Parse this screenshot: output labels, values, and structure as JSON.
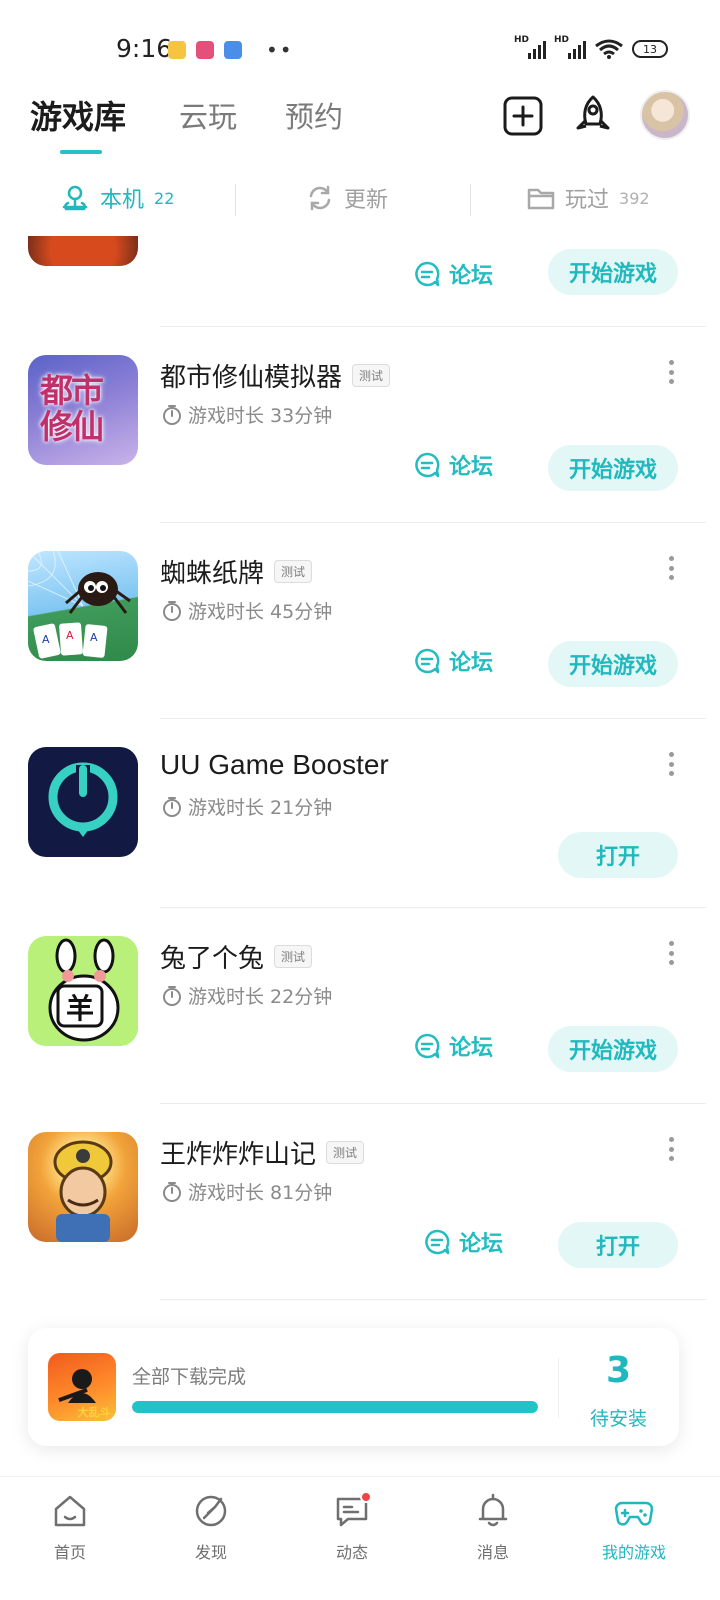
{
  "status_bar": {
    "time": "9:16",
    "signal_1": "HD",
    "signal_2": "HD",
    "battery": "13"
  },
  "header": {
    "tabs": [
      {
        "label": "游戏库",
        "active": true
      },
      {
        "label": "云玩",
        "active": false
      },
      {
        "label": "预约",
        "active": false
      }
    ]
  },
  "subtabs": [
    {
      "label": "本机",
      "count": "22",
      "active": true
    },
    {
      "label": "更新",
      "count": "",
      "active": false
    },
    {
      "label": "玩过",
      "count": "392",
      "active": false
    }
  ],
  "games": [
    {
      "title": "",
      "playtime": "",
      "forum": "论坛",
      "action": "开始游戏"
    },
    {
      "title": "都市修仙模拟器",
      "tag": "测试",
      "playtime": "游戏时长 33分钟",
      "forum": "论坛",
      "action": "开始游戏"
    },
    {
      "title": "蜘蛛纸牌",
      "tag": "测试",
      "playtime": "游戏时长 45分钟",
      "forum": "论坛",
      "action": "开始游戏"
    },
    {
      "title": "UU Game Booster",
      "tag": "",
      "playtime": "游戏时长 21分钟",
      "forum": "",
      "action": "打开"
    },
    {
      "title": "兔了个兔",
      "tag": "测试",
      "playtime": "游戏时长 22分钟",
      "forum": "论坛",
      "action": "开始游戏"
    },
    {
      "title": "王炸炸炸山记",
      "tag": "测试",
      "playtime": "游戏时长 81分钟",
      "forum": "论坛",
      "action": "打开"
    }
  ],
  "icon_text": {
    "dushi": "都市修仙",
    "tu": "羊",
    "dl": "大乱斗"
  },
  "download": {
    "status": "全部下载完成",
    "progress": 1.0,
    "pending_count": "3",
    "pending_label": "待安装"
  },
  "bottom_nav": [
    {
      "label": "首页",
      "icon": "home-icon",
      "active": false
    },
    {
      "label": "发现",
      "icon": "discover-icon",
      "active": false
    },
    {
      "label": "动态",
      "icon": "feed-icon",
      "active": false,
      "badge": true
    },
    {
      "label": "消息",
      "icon": "bell-icon",
      "active": false
    },
    {
      "label": "我的游戏",
      "icon": "gamepad-icon",
      "active": true
    }
  ],
  "colors": {
    "accent": "#20b8be",
    "button_bg": "#e3f7f7",
    "badge": "#f04444"
  }
}
